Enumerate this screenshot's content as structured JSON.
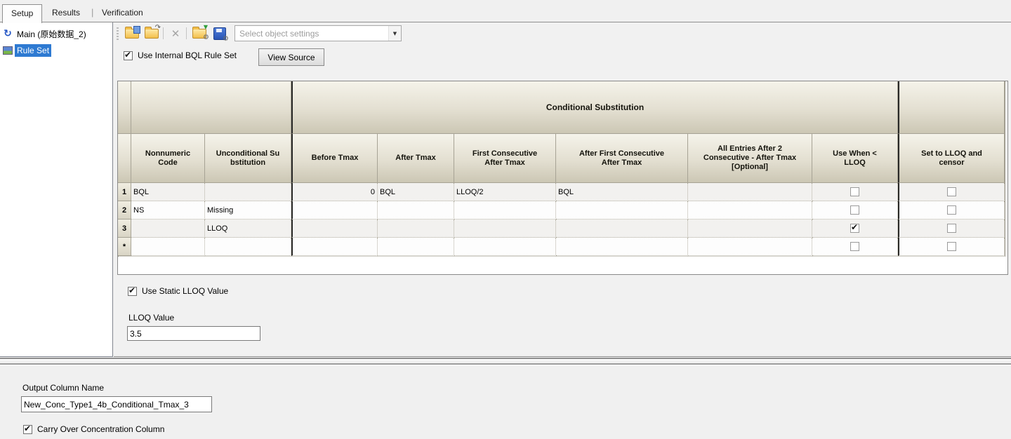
{
  "tabs": {
    "items": [
      {
        "label": "Setup",
        "active": true
      },
      {
        "label": "Results",
        "active": false
      },
      {
        "label": "Verification",
        "active": false
      }
    ],
    "separator": "|"
  },
  "sidebar": {
    "items": [
      {
        "label": "Main (原始数据_2)",
        "icon": "workflow-icon",
        "selected": false
      },
      {
        "label": "Rule Set",
        "icon": "ruleset-icon",
        "selected": true
      }
    ]
  },
  "toolbar": {
    "icons": [
      {
        "name": "open-settings-icon"
      },
      {
        "name": "paste-settings-icon"
      },
      {
        "name": "delete-icon",
        "disabled": true
      },
      {
        "name": "import-settings-icon"
      },
      {
        "name": "save-settings-icon"
      }
    ],
    "settings_combo": {
      "placeholder": "Select object settings"
    }
  },
  "options": {
    "use_internal_bql": {
      "label": "Use Internal BQL Rule Set",
      "checked": true
    },
    "view_source": {
      "label": "View Source"
    }
  },
  "grid": {
    "group_header": {
      "label": "Conditional Substitution"
    },
    "columns": [
      "Nonnumeric Code",
      "Unconditional Substitution",
      "Before Tmax",
      "After Tmax",
      "First Consecutive After Tmax",
      "After First Consecutive After Tmax",
      "All Entries After 2 Consecutive - After Tmax [Optional]",
      "Use When < LLOQ",
      "Set to LLOQ and censor"
    ],
    "rows": [
      {
        "num": "1",
        "nonnumeric_code": "BQL",
        "unconditional_substitution": "",
        "before_tmax": "0",
        "after_tmax": "BQL",
        "first_consecutive_after_tmax": "LLOQ/2",
        "after_first_consecutive_after_tmax": "BQL",
        "all_entries_after_2": "",
        "use_when_lt_lloq": false,
        "set_to_lloq_and_censor": false
      },
      {
        "num": "2",
        "nonnumeric_code": "NS",
        "unconditional_substitution": "Missing",
        "before_tmax": "",
        "after_tmax": "",
        "first_consecutive_after_tmax": "",
        "after_first_consecutive_after_tmax": "",
        "all_entries_after_2": "",
        "use_when_lt_lloq": false,
        "set_to_lloq_and_censor": false
      },
      {
        "num": "3",
        "nonnumeric_code": "",
        "unconditional_substitution": "LLOQ",
        "before_tmax": "",
        "after_tmax": "",
        "first_consecutive_after_tmax": "",
        "after_first_consecutive_after_tmax": "",
        "all_entries_after_2": "",
        "use_when_lt_lloq": true,
        "set_to_lloq_and_censor": false
      },
      {
        "num": "*",
        "nonnumeric_code": "",
        "unconditional_substitution": "",
        "before_tmax": "",
        "after_tmax": "",
        "first_consecutive_after_tmax": "",
        "after_first_consecutive_after_tmax": "",
        "all_entries_after_2": "",
        "use_when_lt_lloq": false,
        "set_to_lloq_and_censor": false
      }
    ]
  },
  "lloq": {
    "use_static": {
      "label": "Use Static LLOQ Value",
      "checked": true
    },
    "value_label": "LLOQ Value",
    "value": "3.5"
  },
  "output": {
    "name_label": "Output Column Name",
    "name_value": "New_Conc_Type1_4b_Conditional_Tmax_3",
    "carry_over": {
      "label": "Carry Over Concentration Column",
      "checked": true
    }
  }
}
